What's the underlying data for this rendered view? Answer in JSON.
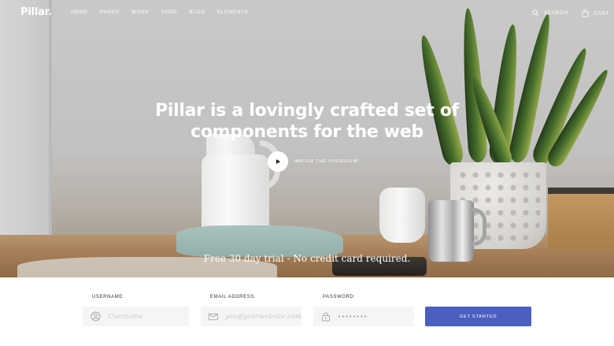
{
  "brand": {
    "logo": "Pillar."
  },
  "nav": {
    "items": [
      {
        "label": "HOME"
      },
      {
        "label": "PAGES"
      },
      {
        "label": "WORK"
      },
      {
        "label": "SHOP"
      },
      {
        "label": "BLOG"
      },
      {
        "label": "ELEMENTS"
      }
    ],
    "search_label": "SEARCH",
    "search_icon": "search-icon",
    "cart_label": "CART",
    "cart_icon": "bag-icon"
  },
  "hero": {
    "headline_line1": "Pillar is a lovingly crafted set of",
    "headline_line2": "components for the web",
    "play_icon": "play-icon",
    "watch_label": "WATCH THE OVERVIEW",
    "trial_text": "Free 30 day trial - No credit card required."
  },
  "form": {
    "username": {
      "label": "USERNAME:",
      "placeholder": "Username",
      "icon": "user-icon"
    },
    "email": {
      "label": "EMAIL ADDRESS:",
      "placeholder": "you@yourwebsite.com",
      "icon": "mail-icon"
    },
    "password": {
      "label": "PASSWORD:",
      "value": "••••••••",
      "icon": "lock-icon"
    },
    "submit_label": "GET STARTED"
  },
  "colors": {
    "accent": "#4b5fc0",
    "field_bg": "#f5f5f5",
    "text_light": "#ffffff"
  }
}
